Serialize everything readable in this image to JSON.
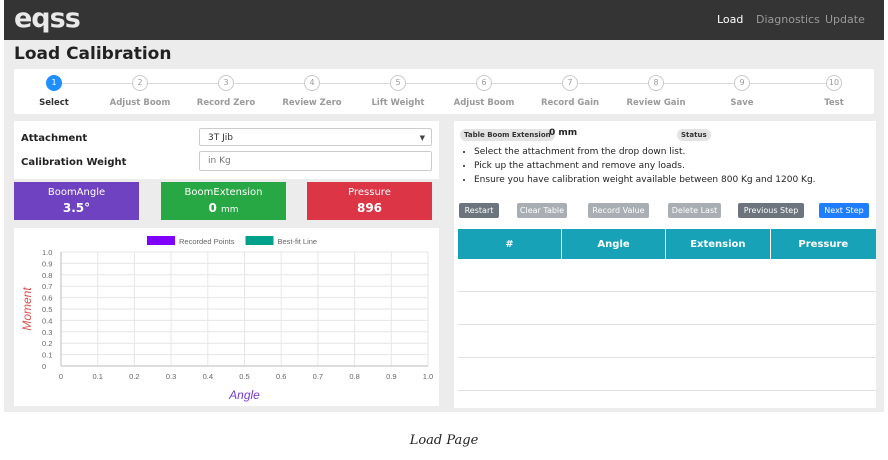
{
  "navbar": {
    "logo_text": "eqss",
    "links": [
      {
        "label": "Load",
        "active": true
      },
      {
        "label": "Diagnostics",
        "active": false
      },
      {
        "label": "Update",
        "active": false
      }
    ]
  },
  "page_title": "Load Calibration",
  "steps": [
    {
      "num": "1",
      "label": "Select",
      "active": true
    },
    {
      "num": "2",
      "label": "Adjust Boom",
      "active": false
    },
    {
      "num": "3",
      "label": "Record Zero",
      "active": false
    },
    {
      "num": "4",
      "label": "Review Zero",
      "active": false
    },
    {
      "num": "5",
      "label": "Lift Weight",
      "active": false
    },
    {
      "num": "6",
      "label": "Adjust Boom",
      "active": false
    },
    {
      "num": "7",
      "label": "Record Gain",
      "active": false
    },
    {
      "num": "8",
      "label": "Review Gain",
      "active": false
    },
    {
      "num": "9",
      "label": "Save",
      "active": false
    },
    {
      "num": "10",
      "label": "Test",
      "active": false
    }
  ],
  "form": {
    "attachment_label": "Attachment",
    "attachment_value": "3T Jib",
    "weight_label": "Calibration Weight",
    "weight_placeholder": "in Kg"
  },
  "tiles": {
    "boom_angle": {
      "title": "BoomAngle",
      "value": "3.5°",
      "color": "#6f42c1"
    },
    "boom_extension": {
      "title": "BoomExtension",
      "value": "0",
      "unit": "mm",
      "color": "#28a745"
    },
    "pressure": {
      "title": "Pressure",
      "value": "896",
      "color": "#dc3545"
    }
  },
  "right": {
    "ext_tag": "Table Boom Extension",
    "ext_value": "0 mm",
    "status_tag": "Status",
    "instructions": [
      "Select the attachment from the drop down list.",
      "Pick up the attachment and remove any loads.",
      "Ensure you have calibration weight available between 800 Kg and 1200 Kg."
    ],
    "buttons": {
      "restart": "Restart",
      "clear_table": "Clear Table",
      "record_value": "Record Value",
      "delete_last": "Delete Last",
      "previous_step": "Previous Step",
      "next_step": "Next Step"
    },
    "table_headers": [
      "#",
      "Angle",
      "Extension",
      "Pressure"
    ]
  },
  "chart_data": {
    "type": "scatter",
    "series": [
      {
        "name": "Recorded Points",
        "color": "#7f00ff",
        "x": [],
        "y": []
      },
      {
        "name": "Best-fit Line",
        "color": "#00a08a",
        "x": [],
        "y": []
      }
    ],
    "xlabel": "Angle",
    "ylabel": "Moment",
    "xlim": [
      0,
      1.0
    ],
    "ylim": [
      0,
      1.0
    ],
    "x_ticks": [
      "0",
      "0.1",
      "0.2",
      "0.3",
      "0.4",
      "0.5",
      "0.6",
      "0.7",
      "0.8",
      "0.9",
      "1.0"
    ],
    "y_ticks": [
      "0",
      "0.1",
      "0.2",
      "0.3",
      "0.4",
      "0.5",
      "0.6",
      "0.7",
      "0.8",
      "0.9",
      "1.0"
    ],
    "grid": true,
    "legend_position": "top"
  },
  "caption": "Load Page"
}
